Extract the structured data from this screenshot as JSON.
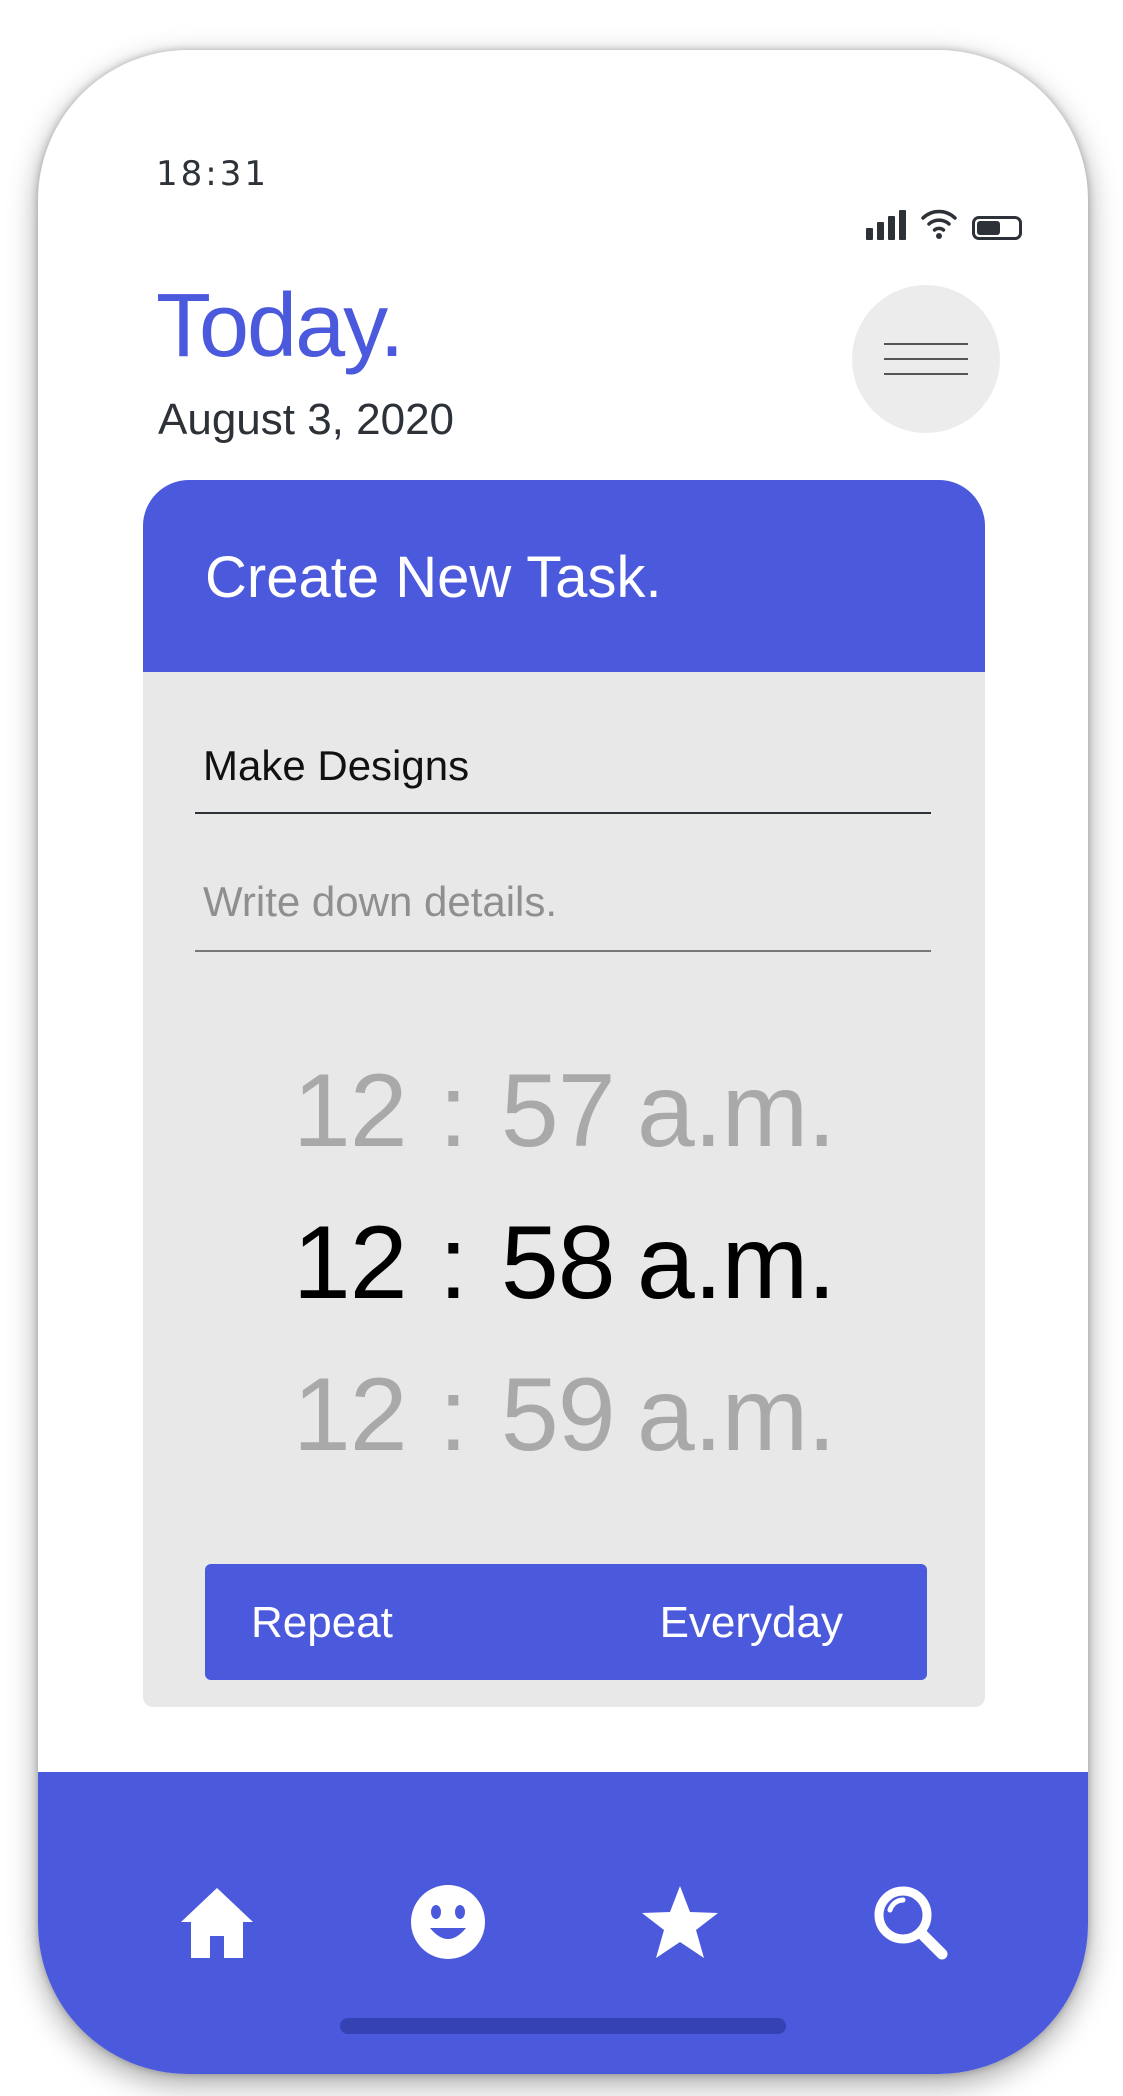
{
  "status_bar": {
    "time": "18:31",
    "icons": [
      "signal-icon",
      "wifi-icon",
      "battery-icon"
    ]
  },
  "header": {
    "title": "Today.",
    "date": "August 3, 2020",
    "menu_icon": "hamburger-icon"
  },
  "task_card": {
    "heading": "Create New Task.",
    "task_name": "Make Designs",
    "details_placeholder": "Write down details.",
    "time_picker": [
      {
        "hour": "12",
        "separator": ":",
        "minute": "57",
        "period": "a.m.",
        "selected": false
      },
      {
        "hour": "12",
        "separator": ":",
        "minute": "58",
        "period": "a.m.",
        "selected": true
      },
      {
        "hour": "12",
        "separator": ":",
        "minute": "59",
        "period": "a.m.",
        "selected": false
      }
    ],
    "repeat": {
      "label": "Repeat",
      "value": "Everyday"
    }
  },
  "bottom_nav": {
    "items": [
      "home-icon",
      "smiley-icon",
      "star-icon",
      "search-icon"
    ]
  },
  "colors": {
    "accent": "#4b59dc",
    "text": "#2d3138",
    "card_bg": "#e8e8e8",
    "dim_text": "#a9a9a9"
  }
}
